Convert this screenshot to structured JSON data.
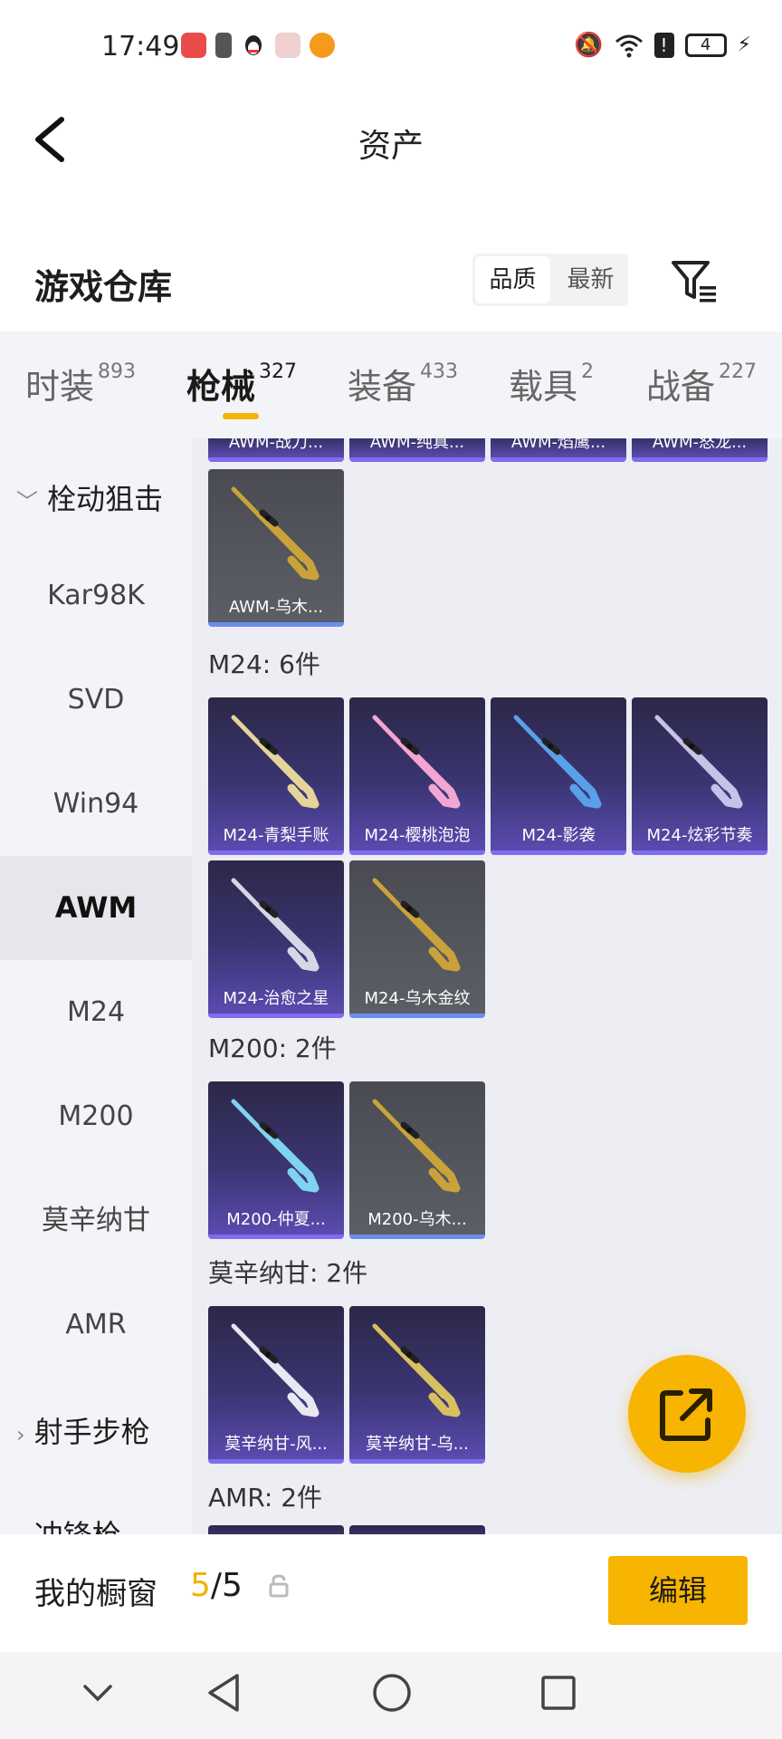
{
  "status_bar": {
    "time": "17:49",
    "apps": [
      {
        "icon": "app-red-icon",
        "color": "#ea4b4b"
      },
      {
        "icon": "battery-app-icon",
        "color": "#555555"
      },
      {
        "icon": "qq-penguin-icon",
        "color": "#222222"
      },
      {
        "icon": "gift-app-icon",
        "color": "#e86060"
      },
      {
        "icon": "fox-app-icon",
        "color": "#f59a1a"
      }
    ],
    "mute_icon": "🔕",
    "wifi_icon": "wifi-icon",
    "alert_icon": "!",
    "battery_level": "4",
    "charging_icon": "⚡"
  },
  "header": {
    "title": "资产",
    "back_icon": "back-arrow-icon"
  },
  "section": {
    "title": "游戏仓库",
    "sort_options": [
      "品质",
      "最新"
    ],
    "active_sort": "品质",
    "filter_icon": "filter-icon"
  },
  "tabs": [
    {
      "label": "时装",
      "count": "893"
    },
    {
      "label": "枪械",
      "count": "327"
    },
    {
      "label": "装备",
      "count": "433"
    },
    {
      "label": "载具",
      "count": "2"
    },
    {
      "label": "战备",
      "count": "227"
    }
  ],
  "active_tab": "枪械",
  "sidebar": {
    "group_bolt": "栓动狙击",
    "items": [
      "Kar98K",
      "SVD",
      "Win94",
      "AWM",
      "M24",
      "M200",
      "莫辛纳甘",
      "AMR"
    ],
    "active_item": "AWM",
    "group_marksman": "射手步枪",
    "group_partial": "冲锋枪"
  },
  "content": {
    "top_row_labels": [
      "AWM-战刀...",
      "AWM-纯真...",
      "AWM-焰鹰...",
      "AWM-怒龙..."
    ],
    "awm_extra": [
      {
        "label": "AWM-乌木...",
        "style": "gray",
        "gun_color": "#c9a33a"
      }
    ],
    "m24": {
      "label": "M24: 6件",
      "items": [
        {
          "label": "M24-青梨手账",
          "style": "purple",
          "gun_color": "#e6d59a"
        },
        {
          "label": "M24-樱桃泡泡",
          "style": "purple",
          "gun_color": "#f3a6d2"
        },
        {
          "label": "M24-影袭",
          "style": "purple",
          "gun_color": "#5aa0e8"
        },
        {
          "label": "M24-炫彩节奏",
          "style": "purple",
          "gun_color": "#c7c2e8"
        },
        {
          "label": "M24-治愈之星",
          "style": "purple",
          "gun_color": "#d6d6e6"
        },
        {
          "label": "M24-乌木金纹",
          "style": "gray",
          "gun_color": "#c9a33a"
        }
      ]
    },
    "m200": {
      "label": "M200: 2件",
      "items": [
        {
          "label": "M200-仲夏...",
          "style": "purple",
          "gun_color": "#7fd3f0"
        },
        {
          "label": "M200-乌木...",
          "style": "gray",
          "gun_color": "#c9a33a"
        }
      ]
    },
    "mosin": {
      "label": "莫辛纳甘: 2件",
      "items": [
        {
          "label": "莫辛纳甘-风...",
          "style": "purple",
          "gun_color": "#e8e8f2"
        },
        {
          "label": "莫辛纳甘-乌...",
          "style": "purple",
          "gun_color": "#d8c060"
        }
      ]
    },
    "amr": {
      "label": "AMR: 2件"
    }
  },
  "fab": {
    "icon": "share-export-icon"
  },
  "bottom_bar": {
    "showcase_label": "我的橱窗",
    "count_current": "5",
    "count_total": "/5",
    "lock_icon": "lock-icon",
    "edit_label": "编辑"
  },
  "system_nav": {
    "icons": [
      "chevron-down-icon",
      "back-triangle-icon",
      "home-circle-icon",
      "recents-square-icon"
    ]
  },
  "colors": {
    "accent": "#f7b400",
    "purple_card": "#3a3470",
    "gray_card": "#55575e"
  }
}
